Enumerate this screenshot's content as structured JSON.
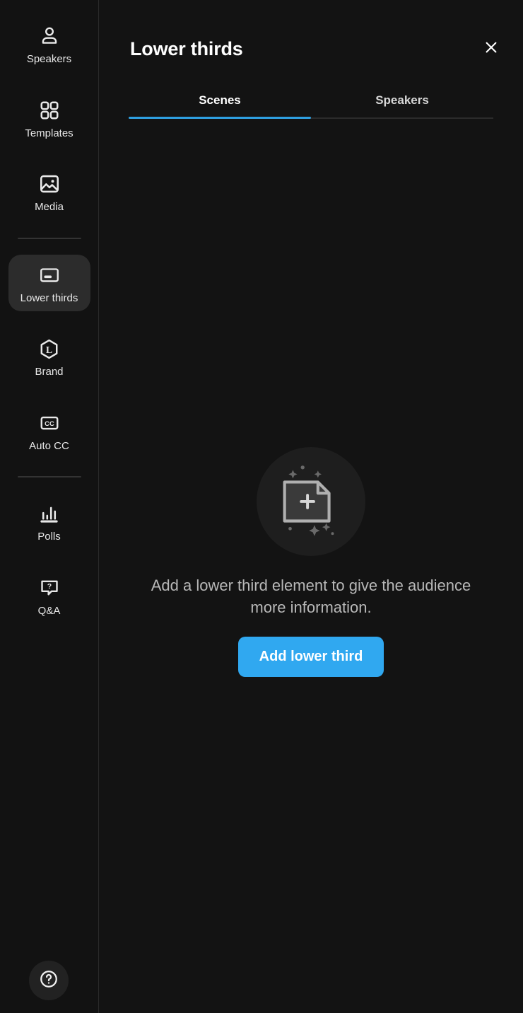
{
  "sidebar": {
    "items": [
      {
        "label": "Speakers",
        "icon": "person-icon",
        "selected": false
      },
      {
        "label": "Templates",
        "icon": "grid-icon",
        "selected": false
      },
      {
        "label": "Media",
        "icon": "image-icon",
        "selected": false
      },
      {
        "label": "Lower thirds",
        "icon": "lower-third-icon",
        "selected": true
      },
      {
        "label": "Brand",
        "icon": "hexagon-l-icon",
        "selected": false
      },
      {
        "label": "Auto CC",
        "icon": "closed-caption-icon",
        "selected": false
      },
      {
        "label": "Polls",
        "icon": "bar-chart-icon",
        "selected": false
      },
      {
        "label": "Q&A",
        "icon": "question-bubble-icon",
        "selected": false
      }
    ],
    "help": {
      "icon": "help-circle-icon",
      "label": "Help"
    }
  },
  "panel": {
    "title": "Lower thirds",
    "close_icon": "close-icon",
    "tabs": [
      {
        "label": "Scenes",
        "active": true
      },
      {
        "label": "Speakers",
        "active": false
      }
    ],
    "empty_state": {
      "illustration_icon": "document-add-sparkle-icon",
      "message": "Add a lower third element to give the audience more information.",
      "button_label": "Add lower third"
    }
  },
  "colors": {
    "accent_blue": "#30a8f0",
    "tab_underline": "#2e9fe0",
    "sidebar_bg": "#121212",
    "panel_bg": "#131313",
    "selected_item_bg": "#2c2c2c"
  }
}
